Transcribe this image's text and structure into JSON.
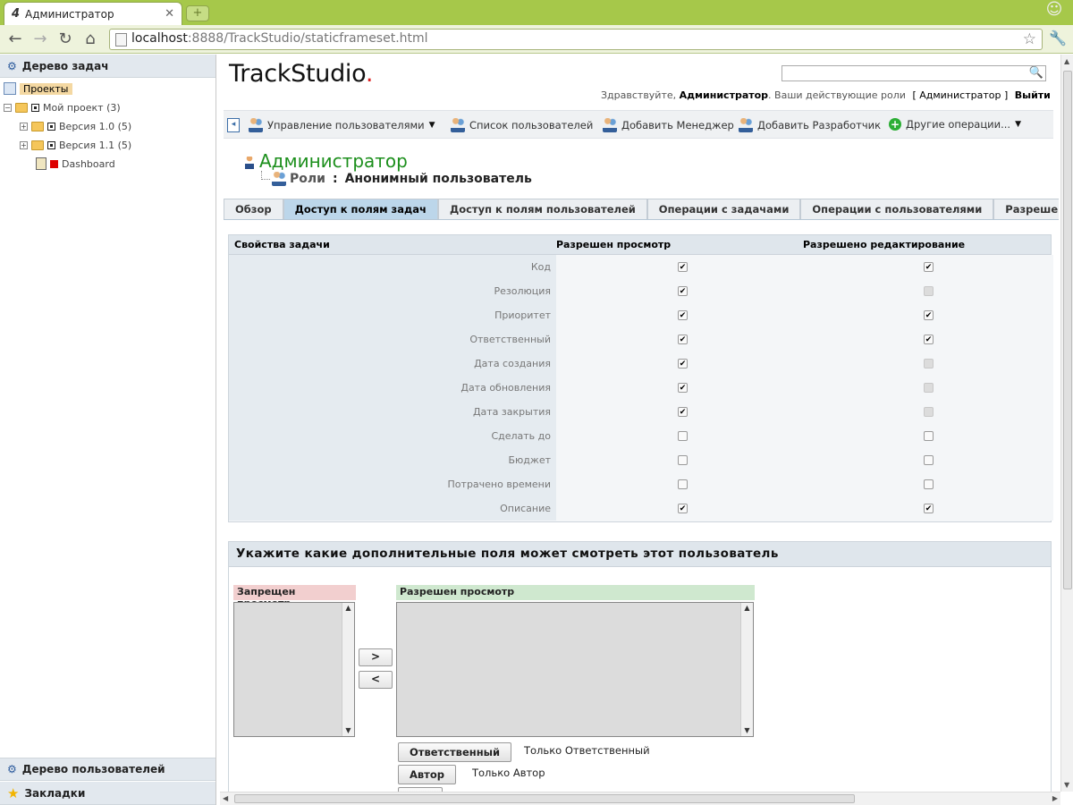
{
  "browser": {
    "tab_title": "Администратор",
    "tab_favicon": "4",
    "url_host": "localhost",
    "url_path": ":8888/TrackStudio/staticframeset.html"
  },
  "left_panel": {
    "task_tree_header": "Дерево задач",
    "projects_label": "Проекты",
    "tree": [
      {
        "label": "Мой проект (3)"
      },
      {
        "label": "Версия 1.0 (5)"
      },
      {
        "label": "Версия 1.1 (5)"
      },
      {
        "label": "Dashboard"
      }
    ],
    "users_tree_header": "Дерево пользователей",
    "bookmarks_header": "Закладки"
  },
  "header": {
    "logo_text": "TrackStudio",
    "logo_dot": ".",
    "greeting_prefix": "Здравствуйте,",
    "greeting_user": "Администратор",
    "greeting_roles_text": ". Ваши действующие роли",
    "greeting_roles": "[ Администратор ]",
    "logout": "Выйти"
  },
  "actions": [
    {
      "label": "Управление пользователями"
    },
    {
      "label": "Список пользователей"
    },
    {
      "label": "Добавить Менеджер"
    },
    {
      "label": "Добавить Разработчик"
    },
    {
      "label": "Другие операции..."
    }
  ],
  "page": {
    "title": "Администратор",
    "roles_link": "Роли",
    "separator": ":",
    "role_name": "Анонимный пользователь"
  },
  "tabs": [
    {
      "label": "Обзор",
      "active": false
    },
    {
      "label": "Доступ к полям задач",
      "active": true
    },
    {
      "label": "Доступ к полям пользователей",
      "active": false
    },
    {
      "label": "Операции с задачами",
      "active": false
    },
    {
      "label": "Операции с пользователями",
      "active": false
    },
    {
      "label": "Разрешения по",
      "active": false
    }
  ],
  "permissions": {
    "col_property": "Свойства задачи",
    "col_view": "Разрешен просмотр",
    "col_edit": "Разрешено редактирование",
    "rows": [
      {
        "field": "Код",
        "view": true,
        "edit": true,
        "edit_disabled": false
      },
      {
        "field": "Резолюция",
        "view": true,
        "edit": false,
        "edit_disabled": true
      },
      {
        "field": "Приоритет",
        "view": true,
        "edit": true,
        "edit_disabled": false
      },
      {
        "field": "Ответственный",
        "view": true,
        "edit": true,
        "edit_disabled": false
      },
      {
        "field": "Дата создания",
        "view": true,
        "edit": false,
        "edit_disabled": true
      },
      {
        "field": "Дата обновления",
        "view": true,
        "edit": false,
        "edit_disabled": true
      },
      {
        "field": "Дата закрытия",
        "view": true,
        "edit": false,
        "edit_disabled": true
      },
      {
        "field": "Сделать до",
        "view": false,
        "edit": false,
        "edit_disabled": false
      },
      {
        "field": "Бюджет",
        "view": false,
        "edit": false,
        "edit_disabled": false
      },
      {
        "field": "Потрачено времени",
        "view": false,
        "edit": false,
        "edit_disabled": false
      },
      {
        "field": "Описание",
        "view": true,
        "edit": true,
        "edit_disabled": false
      }
    ]
  },
  "extra_fields": {
    "title": "Укажите какие дополнительные поля может смотреть этот пользователь",
    "denied_label": "Запрещен просмотр",
    "allowed_label": "Разрешен просмотр",
    "move_right": ">",
    "move_left": "<",
    "buttons": [
      {
        "label": "Ответственный",
        "desc": "Только Ответственный"
      },
      {
        "label": "Автор",
        "desc": "Только Автор"
      }
    ]
  }
}
